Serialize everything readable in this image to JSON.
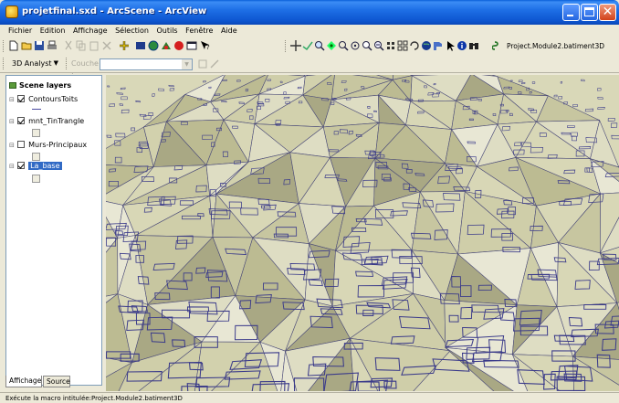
{
  "window": {
    "title": "projetfinal.sxd - ArcScene - ArcView"
  },
  "menu": [
    "Fichier",
    "Edition",
    "Affichage",
    "Sélection",
    "Outils",
    "Fenêtre",
    "Aide"
  ],
  "toolbar2": {
    "analyst_label": "3D Analyst",
    "analyst_arrow": "▼",
    "layer_label": "Couche :",
    "macro_label": "Project.Module2.batiment3D"
  },
  "toc": {
    "header": "Scene layers",
    "layers": [
      {
        "name": "ContoursToits",
        "checked": true,
        "selected": false
      },
      {
        "name": "mnt_TinTrangle",
        "checked": true,
        "selected": false
      },
      {
        "name": "Murs-Principaux",
        "checked": false,
        "selected": false
      },
      {
        "name": "La_base",
        "checked": true,
        "selected": true
      }
    ],
    "tabs": [
      "Affichage",
      "Source"
    ]
  },
  "status": {
    "text": "Exécute la macro intitulée:Project.Module2.batiment3D"
  },
  "colors": {
    "titlebar": "#1e6fe6",
    "selection": "#316ac5",
    "terrain": "#d8d7b6",
    "outline": "#3a3a8a"
  }
}
